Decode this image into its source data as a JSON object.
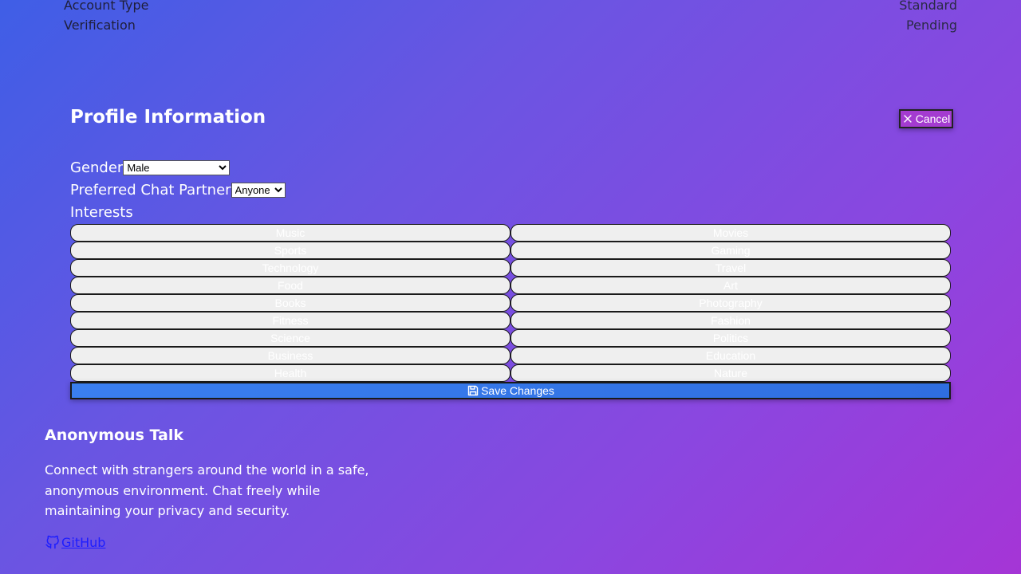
{
  "account": {
    "rows": [
      {
        "label": "Account Type",
        "value": "Standard"
      },
      {
        "label": "Verification",
        "value": "Pending"
      }
    ]
  },
  "profile": {
    "title": "Profile Information",
    "cancel_label": "Cancel",
    "gender_label": "Gender",
    "gender_value": "Male",
    "partner_label": "Preferred Chat Partner",
    "partner_value": "Anyone",
    "interests_label": "Interests",
    "interests": [
      "Music",
      "Movies",
      "Sports",
      "Gaming",
      "Technology",
      "Travel",
      "Food",
      "Art",
      "Books",
      "Photography",
      "Fitness",
      "Fashion",
      "Science",
      "Politics",
      "Business",
      "Education",
      "Health",
      "Nature"
    ],
    "save_label": "Save Changes"
  },
  "footer": {
    "title": "Anonymous Talk",
    "description": "Connect with strangers around the world in a safe, anonymous environment. Chat freely while maintaining your privacy and security.",
    "github_label": "GitHub"
  },
  "icons": {
    "cancel": "close-icon",
    "save": "save-icon",
    "github": "github-icon"
  }
}
